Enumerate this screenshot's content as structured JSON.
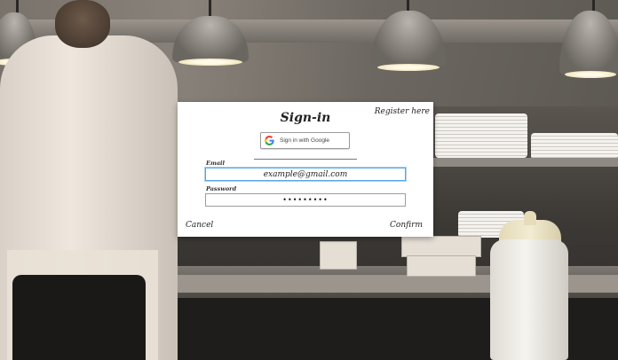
{
  "signin": {
    "title": "Sign-in",
    "register_link": "Register here",
    "google_button": "Sign in with Google",
    "email_label": "Email",
    "email_value": "example@gmail.com",
    "password_label": "Password",
    "password_value": "•••••••••",
    "cancel_label": "Cancel",
    "confirm_label": "Confirm"
  },
  "icons": {
    "google": "google-g-icon"
  },
  "colors": {
    "card_background": "#ffffff",
    "focus_border": "#5aa4e6",
    "google_blue": "#4285F4",
    "google_red": "#EA4335",
    "google_yellow": "#FBBC05",
    "google_green": "#34A853"
  }
}
